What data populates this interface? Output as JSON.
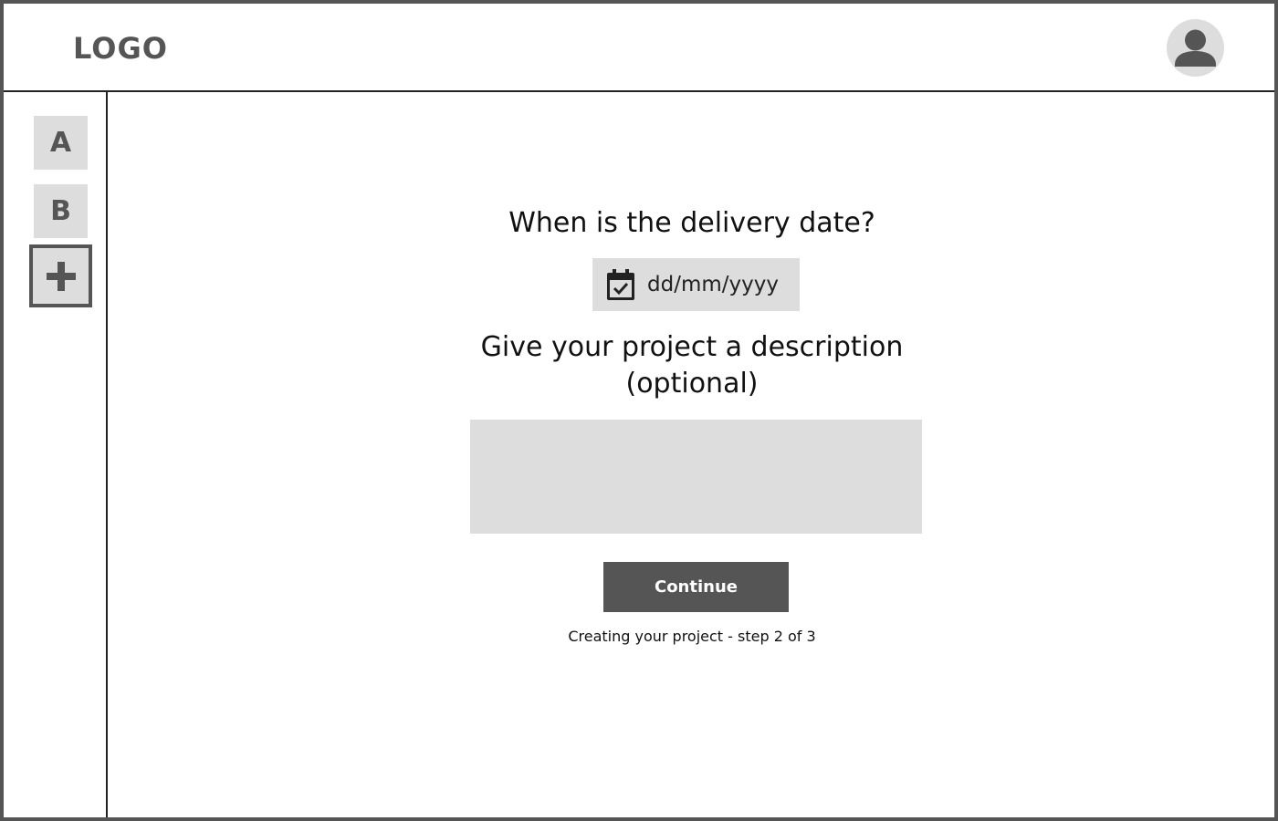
{
  "header": {
    "logo": "LOGO",
    "avatar_icon": "user-avatar-icon"
  },
  "sidebar": {
    "items": [
      {
        "label": "A"
      },
      {
        "label": "B"
      }
    ],
    "add_icon": "plus-icon"
  },
  "form": {
    "delivery_question": "When is the delivery date?",
    "date_placeholder": "dd/mm/yyyy",
    "calendar_icon": "calendar-check-icon",
    "description_question_line1": "Give your project a description",
    "description_question_line2": "(optional)",
    "description_value": "",
    "continue_label": "Continue",
    "step_text": "Creating your project - step 2 of 3"
  },
  "colors": {
    "dark_gray": "#555555",
    "light_gray": "#dddddd",
    "border": "#222222"
  }
}
